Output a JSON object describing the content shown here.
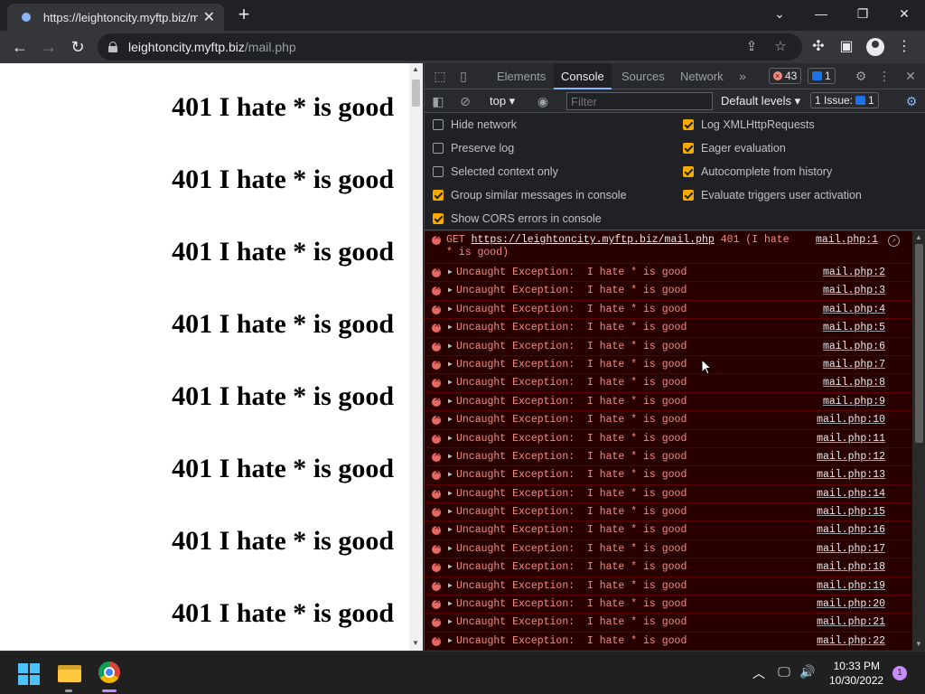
{
  "browser": {
    "tab_title": "https://leightoncity.myftp.biz/mail.php",
    "tab_close": "✕",
    "new_tab": "+",
    "window": {
      "minimize": "—",
      "restore": "❐",
      "close": "✕",
      "tab_search": "⌄"
    },
    "nav": {
      "back": "←",
      "forward": "→",
      "reload": "↻"
    },
    "address": {
      "host": "leightoncity.myftp.biz",
      "path": "/mail.php"
    },
    "icons": {
      "share": "⇪",
      "bookmark": "☆",
      "extensions": "✣",
      "sidepanel": "▣",
      "menu": "⋮"
    }
  },
  "page": {
    "lines": [
      "401 I hate * is good",
      "401 I hate * is good",
      "401 I hate * is good",
      "401 I hate * is good",
      "401 I hate * is good",
      "401 I hate * is good",
      "401 I hate * is good",
      "401 I hate * is good"
    ]
  },
  "devtools": {
    "tabs": [
      "Elements",
      "Console",
      "Sources",
      "Network"
    ],
    "active_tab": "Console",
    "more_tabs": "»",
    "error_count": "43",
    "message_count": "1",
    "context": "top ▾",
    "filter_placeholder": "Filter",
    "levels": "Default levels ▾",
    "issues_label": "1 Issue:",
    "issues_count": "1",
    "settings_left": [
      {
        "label": "Hide network",
        "checked": false
      },
      {
        "label": "Preserve log",
        "checked": false
      },
      {
        "label": "Selected context only",
        "checked": false
      },
      {
        "label": "Group similar messages in console",
        "checked": true
      },
      {
        "label": "Show CORS errors in console",
        "checked": true
      }
    ],
    "settings_right": [
      {
        "label": "Log XMLHttpRequests",
        "checked": true
      },
      {
        "label": "Eager evaluation",
        "checked": true
      },
      {
        "label": "Autocomplete from history",
        "checked": true
      },
      {
        "label": "Evaluate triggers user activation",
        "checked": true
      }
    ],
    "first_message": {
      "method": "GET",
      "url": "https://leightoncity.myftp.biz/mail.php",
      "rest": "401 (I hate * is good)",
      "source": "mail.php:1"
    },
    "exceptions": [
      {
        "text": "Uncaught Exception:  I hate * is good",
        "source": "mail.php:2"
      },
      {
        "text": "Uncaught Exception:  I hate * is good",
        "source": "mail.php:3"
      },
      {
        "text": "Uncaught Exception:  I hate * is good",
        "source": "mail.php:4"
      },
      {
        "text": "Uncaught Exception:  I hate * is good",
        "source": "mail.php:5"
      },
      {
        "text": "Uncaught Exception:  I hate * is good",
        "source": "mail.php:6"
      },
      {
        "text": "Uncaught Exception:  I hate * is good",
        "source": "mail.php:7"
      },
      {
        "text": "Uncaught Exception:  I hate * is good",
        "source": "mail.php:8"
      },
      {
        "text": "Uncaught Exception:  I hate * is good",
        "source": "mail.php:9"
      },
      {
        "text": "Uncaught Exception:  I hate * is good",
        "source": "mail.php:10"
      },
      {
        "text": "Uncaught Exception:  I hate * is good",
        "source": "mail.php:11"
      },
      {
        "text": "Uncaught Exception:  I hate * is good",
        "source": "mail.php:12"
      },
      {
        "text": "Uncaught Exception:  I hate * is good",
        "source": "mail.php:13"
      },
      {
        "text": "Uncaught Exception:  I hate * is good",
        "source": "mail.php:14"
      },
      {
        "text": "Uncaught Exception:  I hate * is good",
        "source": "mail.php:15"
      },
      {
        "text": "Uncaught Exception:  I hate * is good",
        "source": "mail.php:16"
      },
      {
        "text": "Uncaught Exception:  I hate * is good",
        "source": "mail.php:17"
      },
      {
        "text": "Uncaught Exception:  I hate * is good",
        "source": "mail.php:18"
      },
      {
        "text": "Uncaught Exception:  I hate * is good",
        "source": "mail.php:19"
      },
      {
        "text": "Uncaught Exception:  I hate * is good",
        "source": "mail.php:20"
      },
      {
        "text": "Uncaught Exception:  I hate * is good",
        "source": "mail.php:21"
      },
      {
        "text": "Uncaught Exception:  I hate * is good",
        "source": "mail.php:22"
      }
    ]
  },
  "taskbar": {
    "time": "10:33 PM",
    "date": "10/30/2022",
    "notifications": "1",
    "tray": {
      "chevron": "︿",
      "network": "🖵",
      "volume": "🔊"
    }
  },
  "colors": {
    "error_bg": "#290000",
    "error_text": "#f28b82",
    "accent": "#8ab4f8",
    "checkbox": "#f9ab00"
  }
}
